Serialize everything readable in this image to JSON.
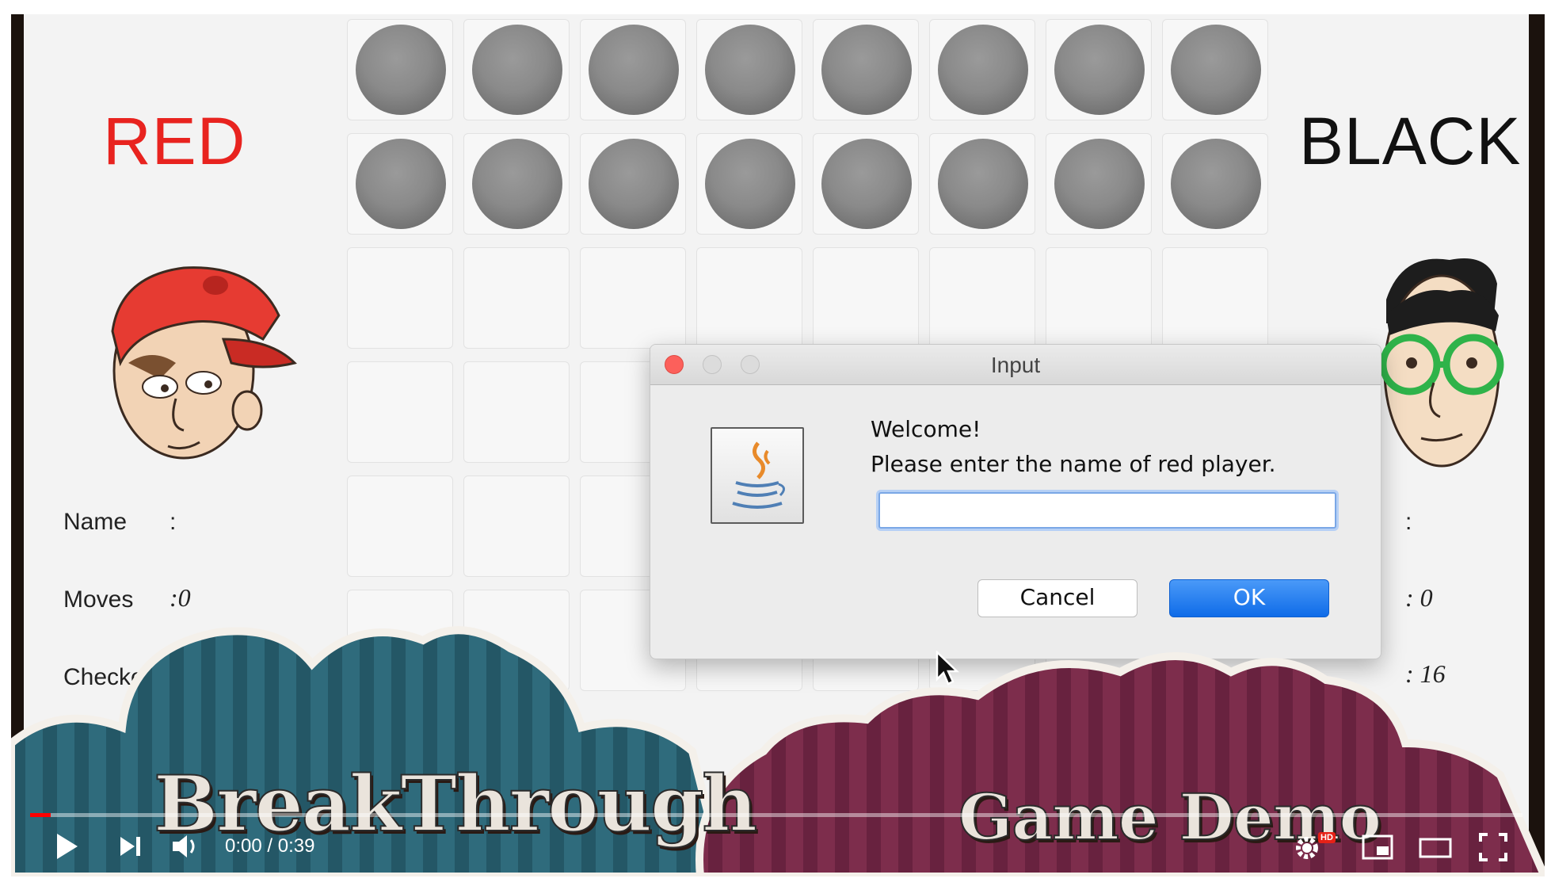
{
  "game": {
    "red_label": "RED",
    "black_label": "BLACK",
    "red_stats": {
      "name_label": "Name",
      "name_sep": ":",
      "moves_label": "Moves",
      "moves_value": ":0",
      "checker_label": "Checker"
    },
    "black_stats": {
      "name_sep": ":",
      "moves_value": ": 0",
      "checker_value": ": 16"
    }
  },
  "dialog": {
    "title": "Input",
    "message_line1": "Welcome!",
    "message_line2": "Please enter the name of red player.",
    "input_value": "",
    "cancel_label": "Cancel",
    "ok_label": "OK"
  },
  "banner": {
    "left_text": "BreakThrough",
    "right_text": "Game Demo"
  },
  "player": {
    "time": "0:00 / 0:39",
    "progress_fraction": 0.0,
    "hd_badge": "HD"
  },
  "colors": {
    "red_title": "#e8231f",
    "piece_gray": "#8a8a8a",
    "ok_blue": "#1a73e8",
    "cloud_teal": "#2c6878",
    "cloud_maroon": "#7a2a4a",
    "progress_red": "#ff0000"
  },
  "icons": [
    "java-icon",
    "play-icon",
    "next-icon",
    "volume-icon",
    "settings-icon",
    "miniplayer-icon",
    "theater-icon",
    "fullscreen-icon",
    "mouse-pointer-icon"
  ]
}
